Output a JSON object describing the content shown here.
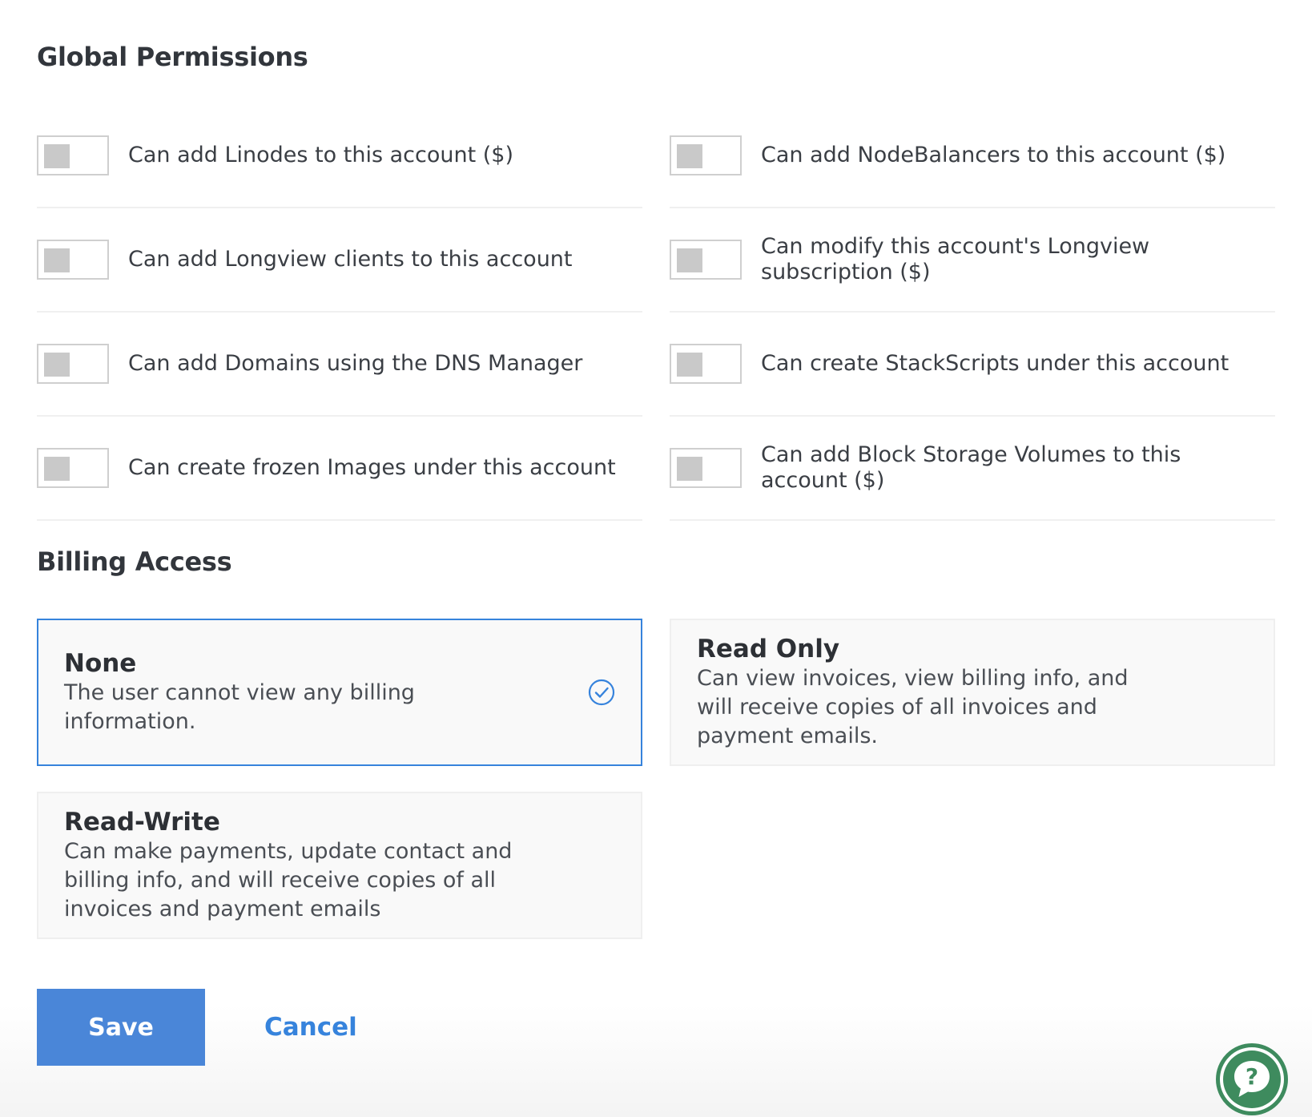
{
  "global_permissions": {
    "title": "Global Permissions",
    "items": [
      {
        "label": "Can add Linodes to this account ($)",
        "enabled": false
      },
      {
        "label": "Can add NodeBalancers to this account ($)",
        "enabled": false
      },
      {
        "label": "Can add Longview clients to this account",
        "enabled": false
      },
      {
        "label": "Can modify this account's Longview subscription ($)",
        "enabled": false
      },
      {
        "label": "Can add Domains using the DNS Manager",
        "enabled": false
      },
      {
        "label": "Can create StackScripts under this account",
        "enabled": false
      },
      {
        "label": "Can create frozen Images under this account",
        "enabled": false
      },
      {
        "label": "Can add Block Storage Volumes to this account ($)",
        "enabled": false
      }
    ]
  },
  "billing_access": {
    "title": "Billing Access",
    "options": [
      {
        "heading": "None",
        "description": "The user cannot view any billing information.",
        "selected": true
      },
      {
        "heading": "Read Only",
        "description": "Can view invoices, view billing info, and will receive copies of all invoices and payment emails.",
        "selected": false
      },
      {
        "heading": "Read-Write",
        "description": "Can make payments, update contact and billing info, and will receive copies of all invoices and payment emails",
        "selected": false
      }
    ]
  },
  "actions": {
    "save_label": "Save",
    "cancel_label": "Cancel"
  },
  "help": {
    "icon": "help-chat-icon",
    "glyph": "?"
  },
  "colors": {
    "accent": "#3683dc",
    "save_button": "#4a86d8",
    "help_button": "#3e8b5e",
    "toggle_knob_off": "#c9c9c9"
  }
}
